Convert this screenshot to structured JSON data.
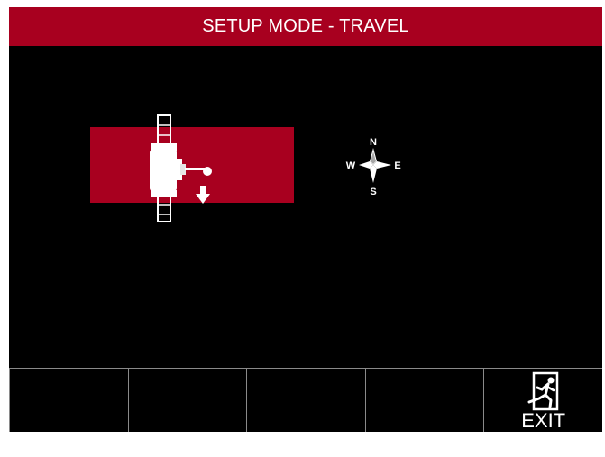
{
  "header": {
    "title": "SETUP MODE - TRAVEL"
  },
  "compass": {
    "icon": "compass-rose-icon",
    "north": "N",
    "south": "S",
    "east": "E",
    "west": "W"
  },
  "machine": {
    "icon": "machine-travel-down-icon"
  },
  "softkeys": [
    {
      "label": ""
    },
    {
      "label": ""
    },
    {
      "label": ""
    },
    {
      "label": ""
    },
    {
      "label": "EXIT",
      "icon": "exit-running-man-icon"
    }
  ],
  "colors": {
    "accent": "#a8001f",
    "background": "#000000",
    "text": "#ffffff",
    "divider": "#8a8a8a"
  }
}
